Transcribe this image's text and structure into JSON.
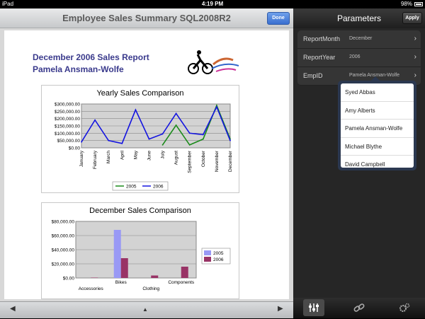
{
  "status_bar": {
    "carrier": "iPad",
    "time": "4:19 PM",
    "battery": "98%"
  },
  "left_nav": {
    "title": "Employee Sales Summary SQL2008R2",
    "done_label": "Done"
  },
  "report": {
    "title_line1": "December 2006 Sales Report",
    "title_line2": "Pamela Ansman-Wolfe"
  },
  "chart_data": [
    {
      "type": "line",
      "title": "Yearly Sales Comparison",
      "categories": [
        "January",
        "February",
        "March",
        "April",
        "May",
        "June",
        "July",
        "August",
        "September",
        "October",
        "November",
        "December"
      ],
      "yticks": [
        "$300,000.00",
        "$250,000.00",
        "$200,000.00",
        "$150,000.00",
        "$100,000.00",
        "$50,000.00",
        "$0.00"
      ],
      "ylim": [
        0,
        300000
      ],
      "series": [
        {
          "name": "2005",
          "color": "#1a8a1a",
          "values": [
            null,
            null,
            null,
            null,
            null,
            null,
            20000,
            155000,
            20000,
            60000,
            290000,
            60000
          ]
        },
        {
          "name": "2006",
          "color": "#1414e0",
          "values": [
            40000,
            190000,
            50000,
            30000,
            260000,
            60000,
            95000,
            235000,
            100000,
            90000,
            280000,
            50000
          ]
        }
      ]
    },
    {
      "type": "bar",
      "title": "December Sales Comparison",
      "categories": [
        "Accessories",
        "Bikes",
        "Clothing",
        "Components"
      ],
      "yticks": [
        "$80,000.00",
        "$60,000.00",
        "$40,000.00",
        "$20,000.00",
        "$0.00"
      ],
      "ylim": [
        0,
        80000
      ],
      "series": [
        {
          "name": "2005",
          "color": "#9999f5",
          "values": [
            0,
            68000,
            0,
            0
          ]
        },
        {
          "name": "2006",
          "color": "#993366",
          "values": [
            500,
            28000,
            3500,
            16000
          ]
        }
      ]
    }
  ],
  "toolbar": {
    "prev": "◀",
    "up": "▲",
    "next": "▶"
  },
  "parameters_panel": {
    "title": "Parameters",
    "apply_label": "Apply",
    "params": [
      {
        "label": "ReportMonth",
        "value": "December"
      },
      {
        "label": "ReportYear",
        "value": "2006"
      },
      {
        "label": "EmpID",
        "value": "Pamela Ansman-Wolfe"
      }
    ],
    "employee_options": [
      "Syed Abbas",
      "Amy Alberts",
      "Pamela Ansman-Wolfe",
      "Michael Blythe",
      "David Campbell"
    ]
  },
  "tabbar": {
    "items": [
      "sliders-icon",
      "link-icon",
      "gears-icon"
    ]
  }
}
